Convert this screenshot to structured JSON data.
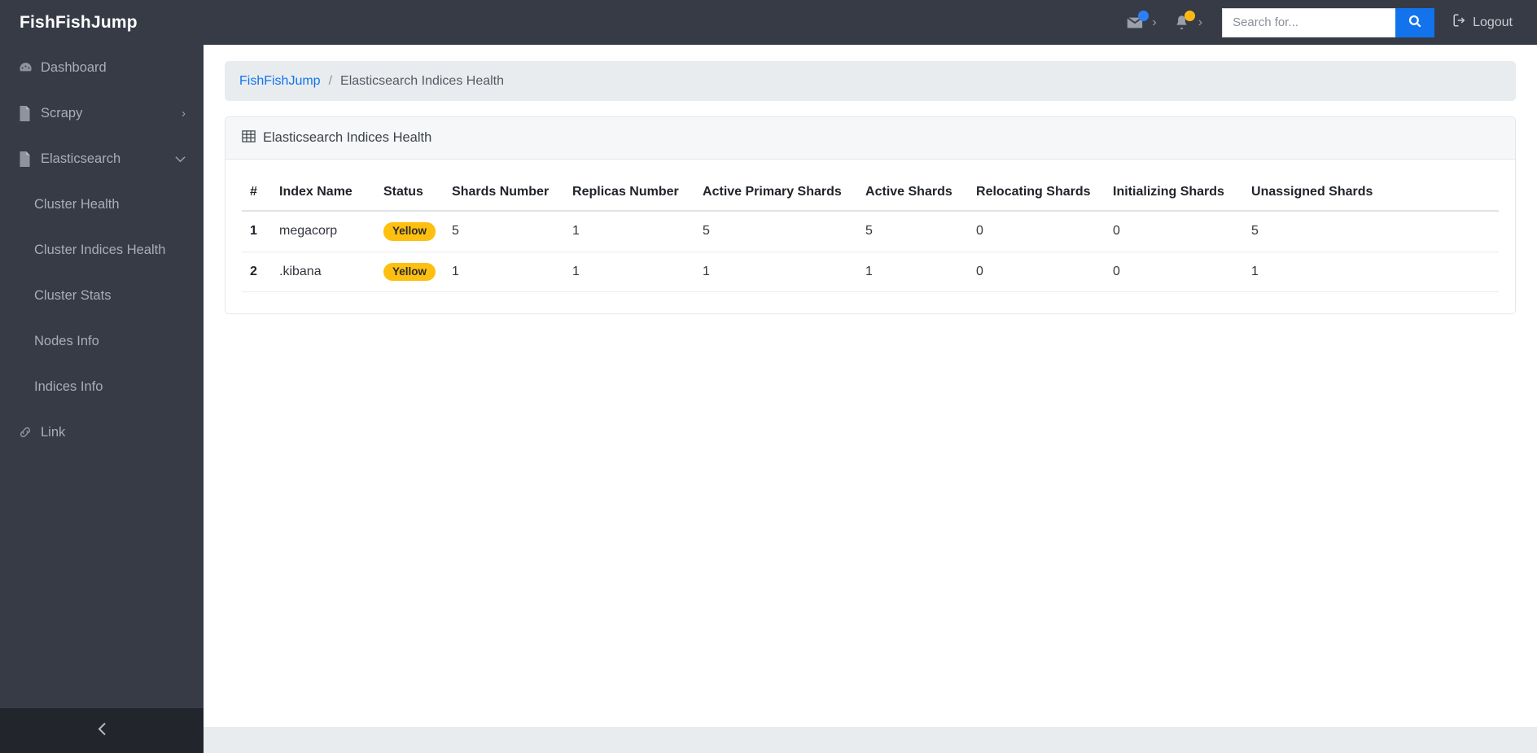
{
  "header": {
    "brand": "FishFishJump",
    "mail_icon": "envelope-icon",
    "bell_icon": "bell-icon",
    "chevron": "›",
    "search": {
      "placeholder": "Search for...",
      "value": "",
      "button_icon": "search-icon"
    },
    "logout_label": "Logout",
    "logout_icon": "sign-out-icon",
    "mail_badge_color": "#2d7ff9",
    "bell_badge_color": "#fdb913",
    "search_button_color": "#1273ec"
  },
  "sidebar": {
    "items": [
      {
        "label": "Dashboard",
        "icon": "tachometer-icon",
        "type": "item",
        "caret": ""
      },
      {
        "label": "Scrapy",
        "icon": "file-icon",
        "type": "item",
        "caret": "›"
      },
      {
        "label": "Elasticsearch",
        "icon": "file-icon",
        "type": "item",
        "caret": "⌄"
      },
      {
        "label": "Cluster Health",
        "icon": "",
        "type": "sub",
        "caret": ""
      },
      {
        "label": "Cluster Indices Health",
        "icon": "",
        "type": "sub",
        "caret": ""
      },
      {
        "label": "Cluster Stats",
        "icon": "",
        "type": "sub",
        "caret": ""
      },
      {
        "label": "Nodes Info",
        "icon": "",
        "type": "sub",
        "caret": ""
      },
      {
        "label": "Indices Info",
        "icon": "",
        "type": "sub",
        "caret": ""
      },
      {
        "label": "Link",
        "icon": "link-icon",
        "type": "item",
        "caret": ""
      }
    ],
    "collapse_icon": "chevron-left-icon"
  },
  "breadcrumb": {
    "root": "FishFishJump",
    "separator": "/",
    "current": "Elasticsearch Indices Health"
  },
  "card": {
    "title": "Elasticsearch Indices Health",
    "title_icon": "table-icon"
  },
  "table": {
    "columns": [
      "#",
      "Index Name",
      "Status",
      "Shards Number",
      "Replicas Number",
      "Active Primary Shards",
      "Active Shards",
      "Relocating Shards",
      "Initializing Shards",
      "Unassigned Shards"
    ],
    "rows": [
      {
        "num": "1",
        "index_name": "megacorp",
        "status": "Yellow",
        "shards_number": "5",
        "replicas_number": "1",
        "active_primary_shards": "5",
        "active_shards": "5",
        "relocating_shards": "0",
        "initializing_shards": "0",
        "unassigned_shards": "5"
      },
      {
        "num": "2",
        "index_name": ".kibana",
        "status": "Yellow",
        "shards_number": "1",
        "replicas_number": "1",
        "active_primary_shards": "1",
        "active_shards": "1",
        "relocating_shards": "0",
        "initializing_shards": "0",
        "unassigned_shards": "1"
      }
    ],
    "status_badge_color": "#fdc010"
  }
}
